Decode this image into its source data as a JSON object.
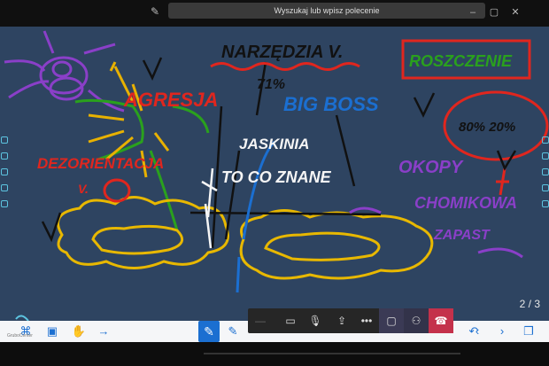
{
  "search": {
    "placeholder": "Wyszukaj lub wpisz polecenie"
  },
  "window": {
    "minimize": "–",
    "maximize": "▢",
    "close": "✕"
  },
  "board": {
    "labels": {
      "narzedzia": "NARZĘDZIA V.",
      "agresja": "AGRESJA",
      "dezorientacja": "DEZORIENTACJA",
      "big_boss": "BIG BOSS",
      "jaskinia": "JASKINIA",
      "to_co_znane": "TO CO ZNANE",
      "rozszczepienie": "ROSZCZENIE",
      "okopy": "OKOPY",
      "chomikowa": "CHOMIKOWA",
      "zapast": "ZAPAST",
      "percent": "80%  20%",
      "boss_pct": "71%",
      "v_mark": "V."
    },
    "page": "2 / 3"
  },
  "toolbar": {
    "app_label": "GruboCenter",
    "icons": [
      "shapes-icon",
      "image-icon",
      "hand-icon",
      "arrow-icon",
      "pen-icon",
      "pen2-icon",
      "marker-icon",
      "highlighter-icon",
      "eraser-icon",
      "select-icon",
      "text-icon",
      "undo-icon",
      "prev-icon",
      "next-icon",
      "pages-icon"
    ]
  },
  "call": {
    "buttons": [
      "video-off",
      "mic-off",
      "share",
      "more",
      "chat",
      "participants",
      "hang-up"
    ]
  }
}
